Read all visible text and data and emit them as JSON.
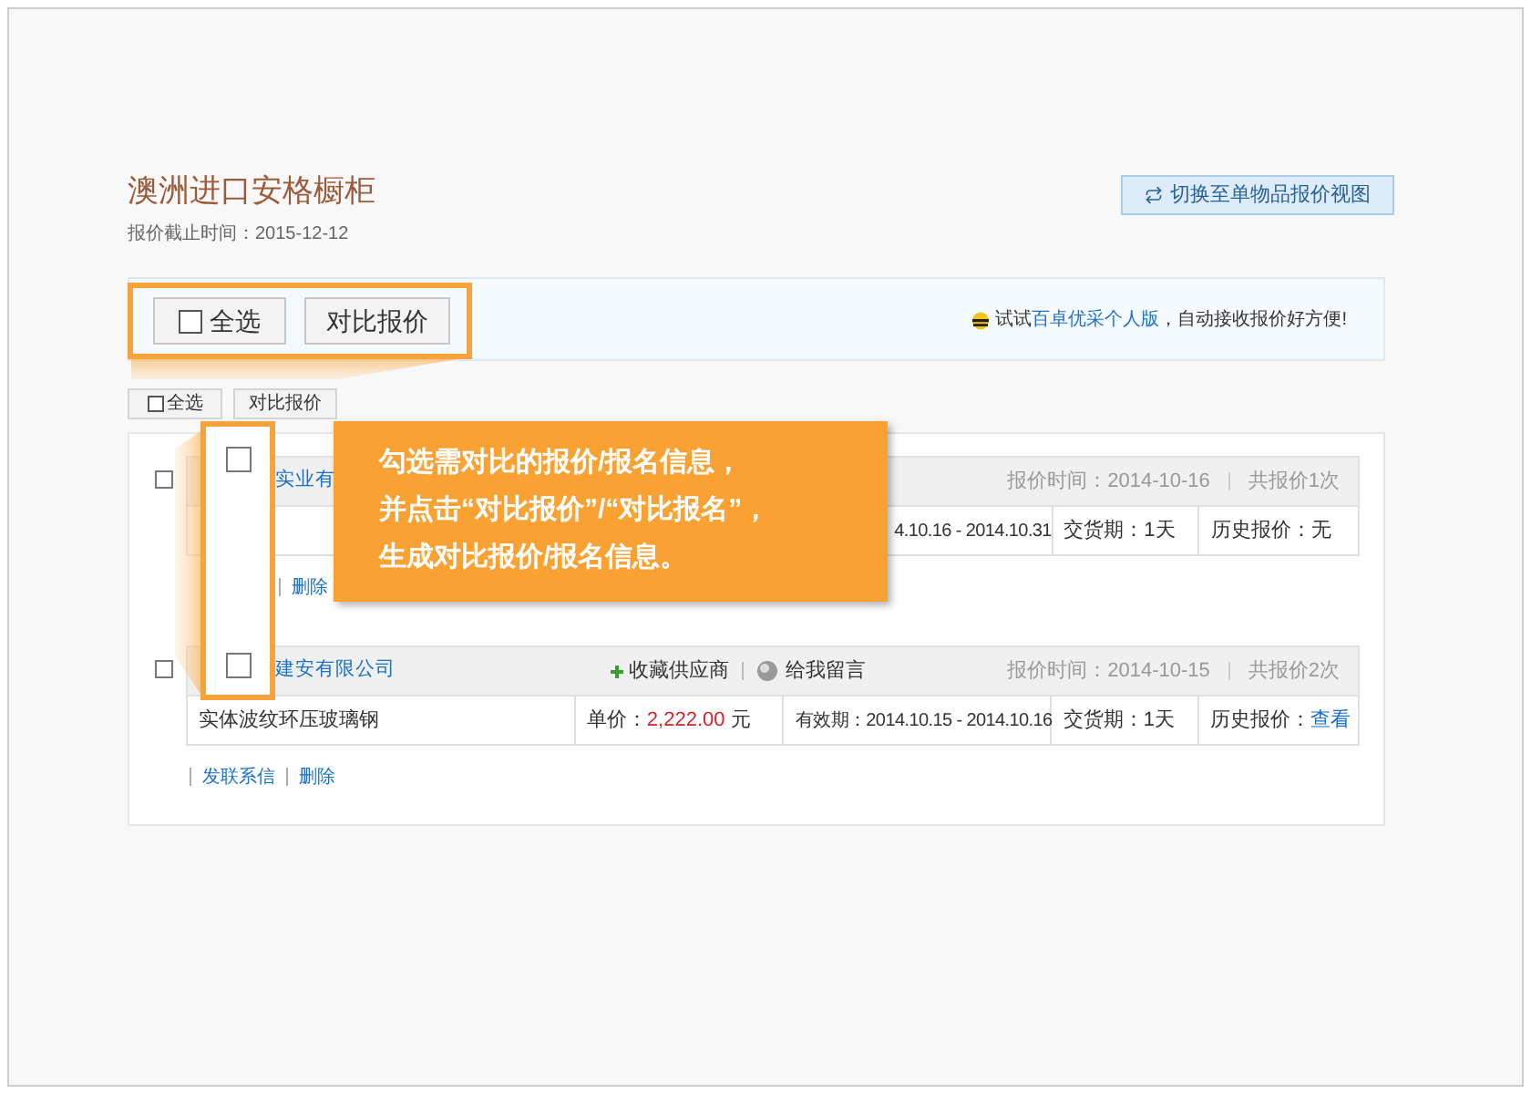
{
  "header": {
    "title": "澳洲进口安格橱柜",
    "deadline": "报价截止时间：2015-12-12",
    "switch_button": "切换至单物品报价视图"
  },
  "toolbar": {
    "tip_prefix": "试试",
    "tip_link": "百卓优采个人版",
    "tip_suffix": "，自动接收报价好方便!"
  },
  "actions": {
    "select_all": {
      "label": "全选",
      "checked": false
    },
    "compare_button": "对比报价"
  },
  "quotes": [
    {
      "checked": false,
      "company": "实业有",
      "quote_time": "报价时间：2014-10-16",
      "quote_count": "共报价1次",
      "validity": "4.10.16 - 2014.10.31",
      "delivery": "交货期：1天",
      "history_label": "历史报价：",
      "history_value": "无",
      "history_link": false,
      "links": [
        "删除"
      ]
    },
    {
      "checked": false,
      "company": "建安有限公司",
      "favorite": "收藏供应商",
      "message": "给我留言",
      "quote_time": "报价时间：2014-10-15",
      "quote_count": "共报价2次",
      "product": "实体波纹环压玻璃钢",
      "price_label": "单价：",
      "price": "2,222.00",
      "price_unit": "元",
      "validity": "有效期：2014.10.15 - 2014.10.16",
      "delivery": "交货期：1天",
      "history_label": "历史报价：",
      "history_value": "查看",
      "history_link": true,
      "links": [
        "发联系信",
        "删除"
      ]
    }
  ],
  "callout": {
    "select_all": {
      "label": "全选",
      "checked": false
    },
    "compare_button": "对比报价",
    "checkboxes": [
      {
        "checked": false
      },
      {
        "checked": false
      }
    ],
    "lines": [
      "勾选需对比的报价/报名信息，",
      "并点击“对比报价”/“对比报名”，",
      "生成对比报价/报名信息。"
    ]
  }
}
